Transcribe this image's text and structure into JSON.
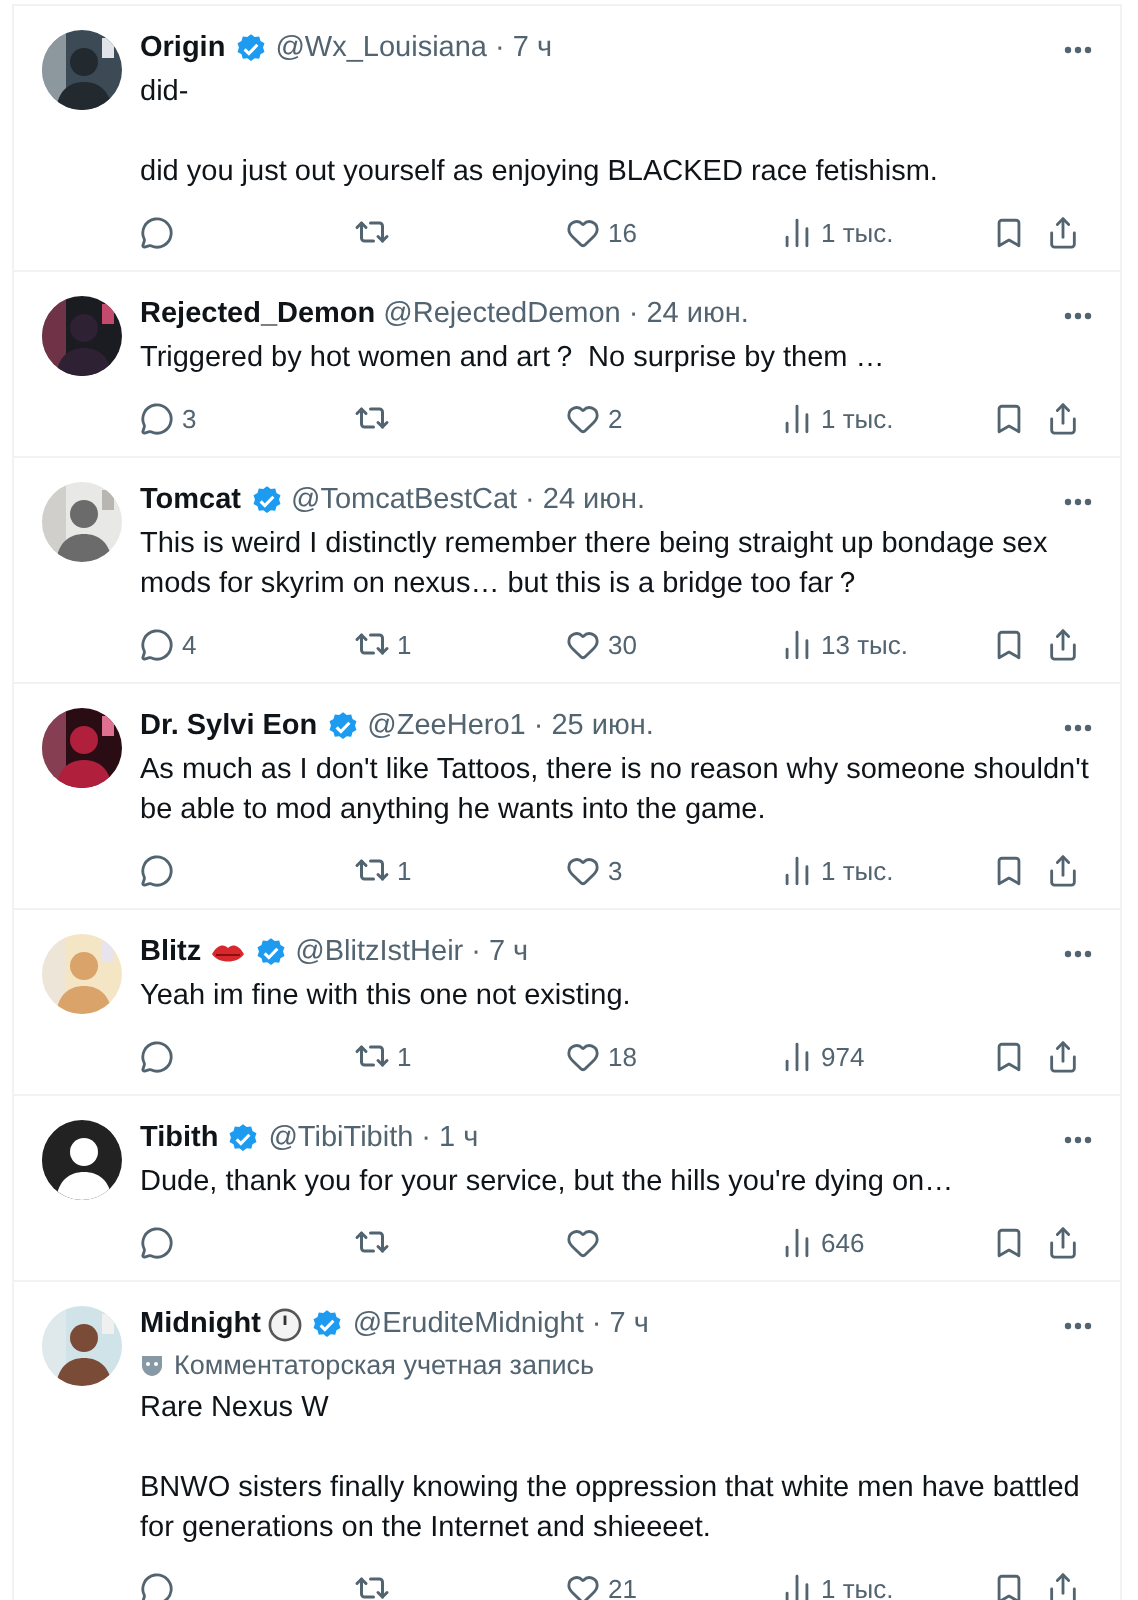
{
  "replies": [
    {
      "name": "Origin",
      "badges": [
        {
          "kind": "verified"
        }
      ],
      "handle": "@Wx_Louisiana",
      "separator": "·",
      "time": "7 ч",
      "paragraphs": [
        "did-",
        "did you just out yourself as enjoying BLACKED race fetishism."
      ],
      "stats": {
        "likes": "16",
        "views": "1 тыс."
      }
    },
    {
      "name": "Rejected_Demon",
      "handle": "@RejectedDemon",
      "separator": "·",
      "time": "24 июн.",
      "paragraphs": [
        "Triggered by hot women and art？ No surprise by them …"
      ],
      "stats": {
        "replies": "3",
        "likes": "2",
        "views": "1 тыс."
      }
    },
    {
      "name": "Tomcat",
      "badges": [
        {
          "kind": "verified"
        }
      ],
      "handle": "@TomcatBestCat",
      "separator": "·",
      "time": "24 июн.",
      "paragraphs": [
        "This is weird I distinctly remember there being straight up bondage sex mods for skyrim on nexus… but this is a bridge too far？"
      ],
      "stats": {
        "replies": "4",
        "reposts": "1",
        "likes": "30",
        "views": "13 тыс."
      }
    },
    {
      "name": "Dr. Sylvi Eon",
      "badges": [
        {
          "kind": "verified"
        }
      ],
      "handle": "@ZeeHero1",
      "separator": "·",
      "time": "25 июн.",
      "paragraphs": [
        "As much as I don't like Tattoos, there is no reason why someone shouldn't be able to mod anything he wants into the game."
      ],
      "stats": {
        "reposts": "1",
        "likes": "3",
        "views": "1 тыс."
      }
    },
    {
      "name": "Blitz",
      "badges": [
        {
          "kind": "lips"
        },
        {
          "kind": "verified"
        }
      ],
      "handle": "@BlitzIstHeir",
      "separator": "·",
      "time": "7 ч",
      "paragraphs": [
        "Yeah im fine with this one not existing."
      ],
      "stats": {
        "reposts": "1",
        "likes": "18",
        "views": "974"
      }
    },
    {
      "name": "Tibith",
      "badges": [
        {
          "kind": "verified"
        }
      ],
      "handle": "@TibiTibith",
      "separator": "·",
      "time": "1 ч",
      "paragraphs": [
        "Dude, thank you for your service, but the hills you're dying on…"
      ],
      "stats": {
        "views": "646"
      }
    },
    {
      "name": "Midnight",
      "badges": [
        {
          "kind": "clock"
        },
        {
          "kind": "verified"
        }
      ],
      "handle": "@EruditeMidnight",
      "separator": "·",
      "time": "7 ч",
      "account_note": "Комментаторская учетная запись",
      "paragraphs": [
        "Rare Nexus W",
        "BNWO sisters finally knowing the oppression that white men have battled for generations on the Internet and shieeeet."
      ],
      "stats": {
        "likes": "21",
        "views": "1 тыс."
      }
    }
  ]
}
